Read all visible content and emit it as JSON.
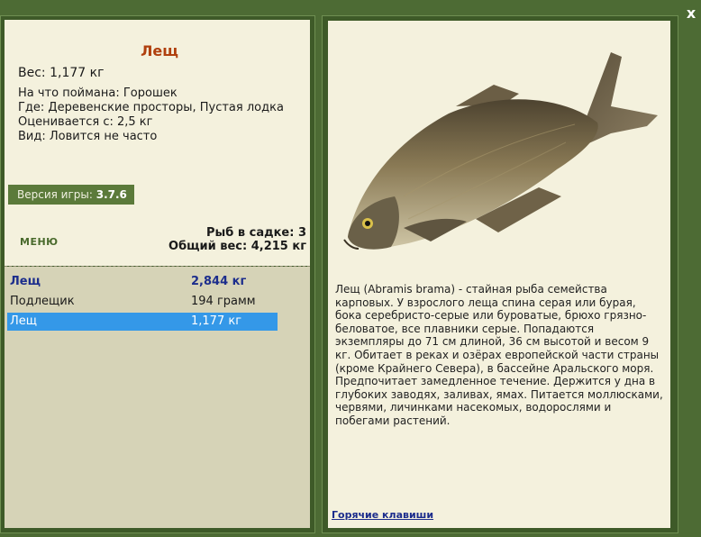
{
  "close_label": "x",
  "fish": {
    "title": "Лещ",
    "weight": "Вес: 1,177 кг",
    "caught_on": "На что поймана: Горошек",
    "location": "Где: Деревенские просторы, Пустая лодка",
    "rated_from": "Оценивается с: 2,5 кг",
    "type": "Вид: Ловится не часто"
  },
  "version": {
    "label": "Версия игры:",
    "value": "3.7.6"
  },
  "menu_label": "МЕНЮ",
  "stats": {
    "fish_in_keepnet": "Рыб в садке: 3",
    "total_weight": "Общий вес: 4,215 кг"
  },
  "catch_list": [
    {
      "name": "Лещ",
      "weight": "2,844 кг",
      "style": "bold"
    },
    {
      "name": "Подлещик",
      "weight": "194 грамм",
      "style": "normal"
    },
    {
      "name": "Лещ",
      "weight": "1,177 кг",
      "style": "selected"
    }
  ],
  "description": "Лещ (Abramis brama) - стайная рыба семейства карповых. У взрослого леща спина серая или бурая, бока серебристо-серые или буроватые, брюхо грязно-беловатое, все плавники серые. Попадаются экземпляры до 71 см длиной, 36 см высотой и весом 9 кг. Обитает в реках и озёрах европейской части страны (кроме Крайнего Севера), в бассейне Аральского моря. Предпочитает замедленное течение. Держится у дна в глубоких заводях, заливах, ямах. Питается моллюсками, червями, личинками насекомых, водорослями и побегами растений.",
  "hotkeys_label": "Горячие клавиши",
  "colors": {
    "background": "#4d6b34",
    "panel": "#f4f1dd",
    "list_bg": "#d6d3b7",
    "title": "#b0400e",
    "link": "#1c2d8c",
    "selected": "#3498e8"
  },
  "icons": {
    "close": "close-icon",
    "fish_image": "bream-fish-image"
  }
}
